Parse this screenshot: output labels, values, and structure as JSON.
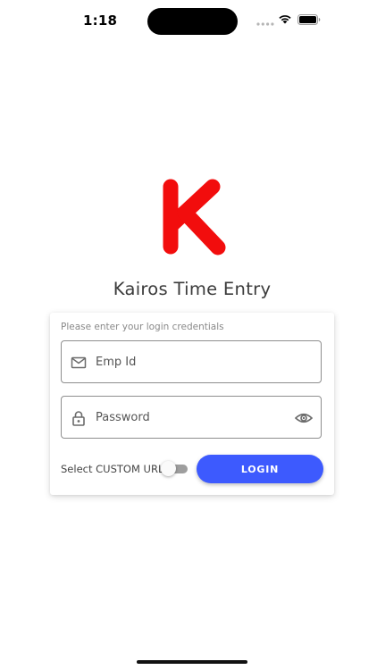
{
  "status_bar": {
    "time": "1:18",
    "icons": [
      "cellular-signal-icon",
      "wifi-icon",
      "battery-icon"
    ]
  },
  "logo": {
    "icon": "kairos-k-logo",
    "color": "#f20d0d"
  },
  "app": {
    "title": "Kairos Time Entry"
  },
  "login_card": {
    "hint": "Please enter your login credentials",
    "emp_id": {
      "value": "",
      "placeholder": "Emp Id",
      "icon": "mail-icon"
    },
    "password": {
      "value": "",
      "placeholder": "Password",
      "icon": "lock-icon",
      "toggle_icon": "eye-icon"
    },
    "custom_url": {
      "label": "Select CUSTOM URL",
      "enabled": false
    },
    "login_button": {
      "label": "LOGIN",
      "color": "#3d5afe"
    }
  }
}
